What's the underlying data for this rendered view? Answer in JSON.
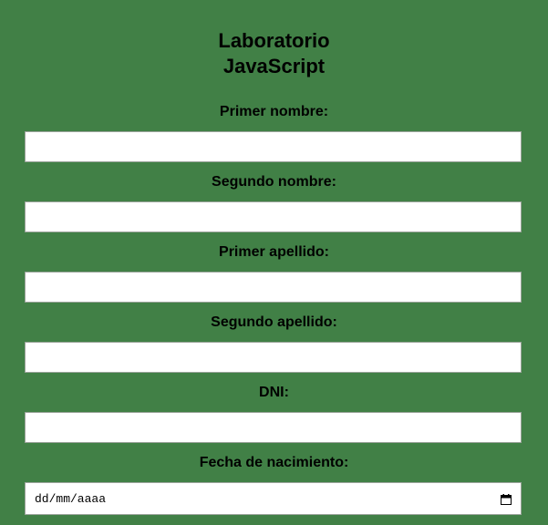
{
  "header": {
    "title_line1": "Laboratorio",
    "title_line2": "JavaScript"
  },
  "form": {
    "fields": [
      {
        "label": "Primer nombre:",
        "value": ""
      },
      {
        "label": "Segundo nombre:",
        "value": ""
      },
      {
        "label": "Primer apellido:",
        "value": ""
      },
      {
        "label": "Segundo apellido:",
        "value": ""
      },
      {
        "label": "DNI:",
        "value": ""
      }
    ],
    "birthdate": {
      "label": "Fecha de nacimiento:",
      "placeholder": "dd/mm/aaaa",
      "icon": "calendar-icon"
    }
  },
  "colors": {
    "background": "#418046",
    "input_background": "#ffffff",
    "text": "#000000"
  }
}
